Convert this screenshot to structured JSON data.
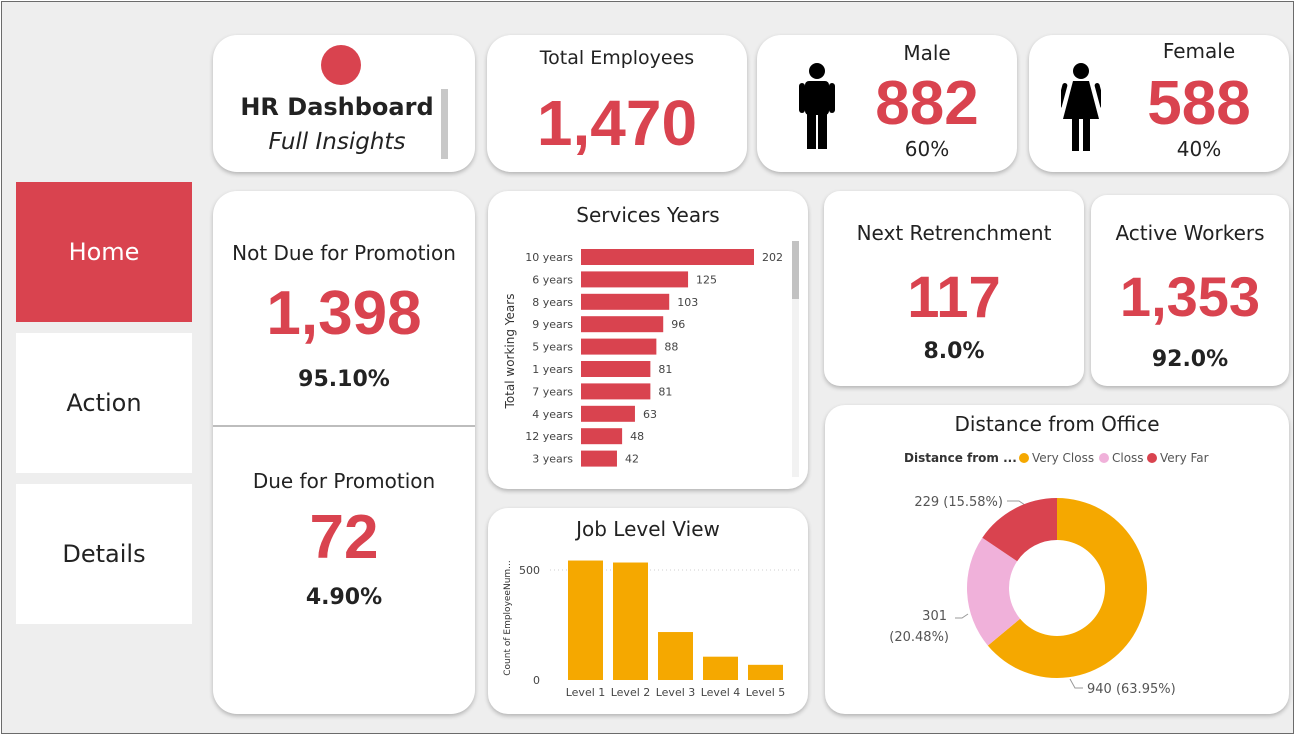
{
  "nav": {
    "home": "Home",
    "action": "Action",
    "details": "Details"
  },
  "header": {
    "title": "HR Dashboard",
    "subtitle": "Full Insights"
  },
  "kpi": {
    "total": {
      "label": "Total Employees",
      "value": "1,470"
    },
    "male": {
      "label": "Male",
      "value": "882",
      "pct": "60%"
    },
    "female": {
      "label": "Female",
      "value": "588",
      "pct": "40%"
    },
    "not_due": {
      "label": "Not Due for Promotion",
      "value": "1,398",
      "pct": "95.10%"
    },
    "due": {
      "label": "Due for Promotion",
      "value": "72",
      "pct": "4.90%"
    },
    "retrench": {
      "label": "Next Retrenchment",
      "value": "117",
      "pct": "8.0%"
    },
    "active": {
      "label": "Active Workers",
      "value": "1,353",
      "pct": "92.0%"
    }
  },
  "colors": {
    "accent": "#d9434f",
    "orange": "#f5a800",
    "pink": "#f0b1da",
    "red": "#d9434f"
  },
  "icons": {
    "male": "male-person-icon",
    "female": "female-person-icon",
    "logo": "red-circle-logo"
  },
  "chart_data": [
    {
      "type": "bar",
      "orientation": "horizontal",
      "title": "Services Years",
      "ylabel": "Total working Years",
      "categories": [
        "10 years",
        "6 years",
        "8 years",
        "9 years",
        "5 years",
        "1 years",
        "7 years",
        "4 years",
        "12 years",
        "3 years"
      ],
      "values": [
        202,
        125,
        103,
        96,
        88,
        81,
        81,
        63,
        48,
        42
      ],
      "data_labels": true
    },
    {
      "type": "bar",
      "title": "Job Level View",
      "ylabel": "Count of EmployeeNum...",
      "categories": [
        "Level 1",
        "Level 2",
        "Level 3",
        "Level 4",
        "Level 5"
      ],
      "values": [
        543,
        534,
        218,
        106,
        69
      ],
      "yticks": [
        "0",
        "500"
      ],
      "ylim": [
        0,
        600
      ]
    },
    {
      "type": "pie",
      "donut": true,
      "title": "Distance from Office",
      "legend_title": "Distance from ...",
      "legend_position": "top",
      "labels": [
        "Very Closs",
        "Closs",
        "Very Far"
      ],
      "values": [
        940,
        301,
        229
      ],
      "data_labels": [
        "940 (63.95%)",
        "301",
        "(20.48%)",
        "229 (15.58%)"
      ]
    }
  ]
}
